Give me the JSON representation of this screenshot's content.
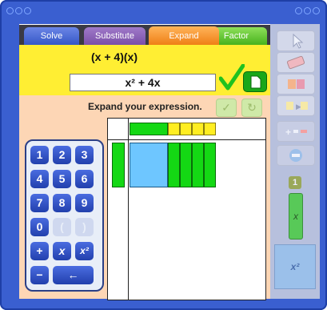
{
  "tabs": {
    "solve": "Solve",
    "substitute": "Substitute",
    "expand": "Expand",
    "factor": "Factor"
  },
  "problem": {
    "expression": "(x + 4)(x)",
    "answer": "x² + 4x"
  },
  "prompt": "Expand your expression.",
  "keypad": {
    "digits": [
      "1",
      "2",
      "3",
      "4",
      "5",
      "6",
      "7",
      "8",
      "9",
      "0"
    ],
    "extra": [
      "(",
      ")"
    ],
    "ops": [
      "+",
      "x",
      "x²",
      "−",
      "←"
    ]
  },
  "side": {
    "count": "1",
    "x_label": "x",
    "x2_label": "x²"
  },
  "colors": {
    "accent_expand": "#ee7d12",
    "green": "#14d814",
    "yellow": "#ffee22",
    "blue": "#6ec6ff"
  }
}
